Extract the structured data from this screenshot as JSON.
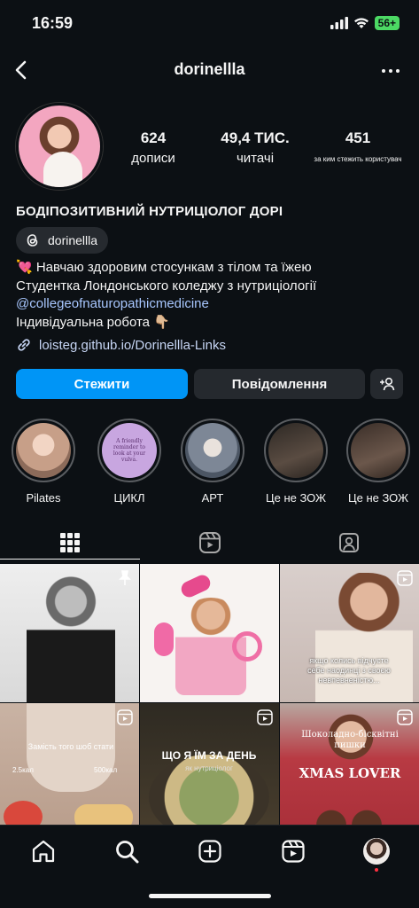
{
  "status_bar": {
    "time": "16:59",
    "battery": "56+"
  },
  "header": {
    "username": "dorinellla"
  },
  "stats": [
    {
      "value": "624",
      "label": "дописи"
    },
    {
      "value": "49,4 ТИС.",
      "label": "читачі"
    },
    {
      "value": "451",
      "label": "за ким стежить користувач"
    }
  ],
  "profile": {
    "name": "БОДІПОЗИТИВНИЙ НУТРИЦІОЛОГ ДОРІ",
    "threads_handle": "dorinellla",
    "bio_line1": "💘 Навчаю здоровим стосункам з тілом та їжею",
    "bio_line2": "Студентка Лондонського коледжу з нутриціології",
    "bio_mention": "@collegeofnaturopathicmedicine",
    "bio_line4": "Індивідуальна робота 👇🏼",
    "link": "loisteg.github.io/Dorinellla-Links"
  },
  "buttons": {
    "follow": "Стежити",
    "message": "Повідомлення"
  },
  "highlights": [
    {
      "label": "Pilates",
      "color": "#d9b9a6"
    },
    {
      "label": "ЦИКЛ",
      "color": "#c8a6e0",
      "text": "A friendly reminder to look at your vulva."
    },
    {
      "label": "АРТ",
      "color": "#9aa6b4"
    },
    {
      "label": "Це не ЗОЖ",
      "color": "#3b3430"
    },
    {
      "label": "Це не ЗОЖ",
      "color": "#4a3d36"
    }
  ],
  "grid_posts": [
    {
      "bg": "#e8e8e8",
      "caption": ""
    },
    {
      "bg": "#f4f0ee",
      "caption": ""
    },
    {
      "bg": "#d8cfcc",
      "caption": "якщо колись відчуєте себе наодинці з своєю невпевненістю..."
    },
    {
      "bg": "#c9b3a4",
      "caption_top": "Замість того шоб стати",
      "left_tag": "2.5кал",
      "right_tag": "500кал"
    },
    {
      "bg": "#3a3a2e",
      "caption": "ЩО Я ЇМ ЗА ДЕНЬ",
      "sub": "як нутриціолог"
    },
    {
      "bg": "#b83a43",
      "caption": "Шоколадно-бісквітні пишки",
      "sub": "XMAS LOVER"
    }
  ]
}
